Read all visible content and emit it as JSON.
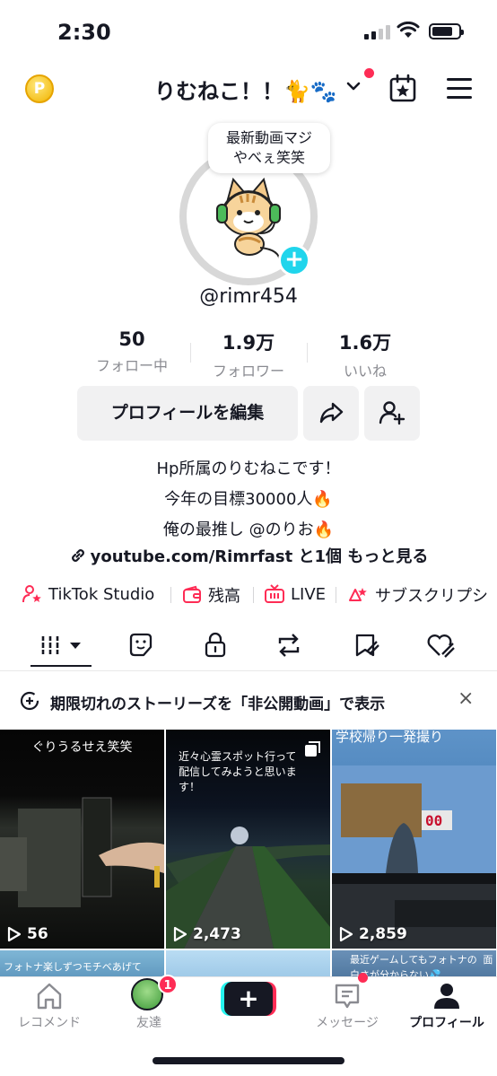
{
  "status_bar": {
    "time": "2:30"
  },
  "header": {
    "username": "りむねこ！！🐈🐾",
    "dropdown_icon": "chevron-down-icon"
  },
  "profile": {
    "bubble_text_line1": "最新動画マジ",
    "bubble_text_line2": "やべぇ笑笑",
    "handle": "@rimr454",
    "coin_symbol": "P"
  },
  "stats": [
    {
      "value": "50",
      "label": "フォロー中"
    },
    {
      "value": "1.9万",
      "label": "フォロワー"
    },
    {
      "value": "1.6万",
      "label": "いいね"
    }
  ],
  "actions": {
    "edit_label": "プロフィールを編集"
  },
  "bio": {
    "line1": "Hp所属のりむねこです！",
    "line2": "今年の目標30000人🔥",
    "line3": "俺の最推し @のりお🔥",
    "link": "youtube.com/Rimrfast",
    "link_suffix": "と1個 もっと見る"
  },
  "tools": [
    {
      "label": "TikTok Studio",
      "icon": "person-star-icon"
    },
    {
      "label": "残高",
      "icon": "wallet-icon"
    },
    {
      "label": "LIVE",
      "icon": "live-tv-icon"
    },
    {
      "label": "サブスクリプシ",
      "icon": "subscription-icon"
    }
  ],
  "tabs": [
    "videos-grid-icon",
    "stickers-icon",
    "lock-icon",
    "repost-icon",
    "favorites-icon",
    "liked-icon"
  ],
  "banner": {
    "text": "期限切れのストーリーズを「非公開動画」で表示",
    "close": "×"
  },
  "videos": [
    {
      "caption": "ぐりうるせえ笑笑",
      "views": "56"
    },
    {
      "caption": "近々心霊スポット行って 配信してみようと思いま す！",
      "views": "2,473"
    },
    {
      "caption": "学校帰り一発撮り",
      "views": "2,859"
    },
    {
      "caption": "フォトナ楽しずつモチベあげて",
      "views": ""
    },
    {
      "caption": "",
      "views": ""
    },
    {
      "caption": "最近ゲームしてもフォトナの 面白さが分からない💦",
      "views": ""
    }
  ],
  "nav": {
    "home": "レコメンド",
    "friends": "友達",
    "friends_badge": "1",
    "create": "+",
    "inbox": "メッセージ",
    "profile": "プロフィール"
  },
  "colors": {
    "accent": "#fe2c55",
    "cyan": "#25f4ee",
    "badge_blue": "#20d5ec"
  }
}
